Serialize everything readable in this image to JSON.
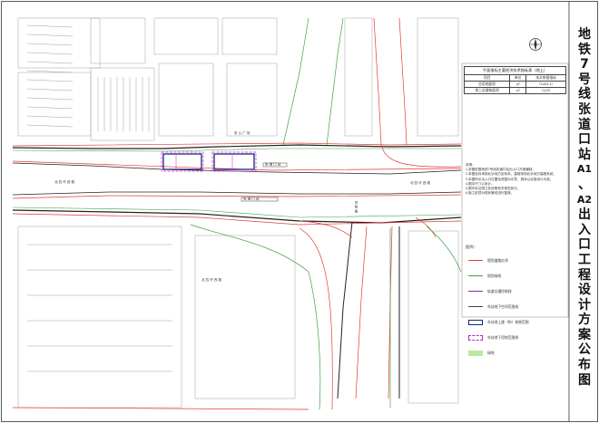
{
  "title_chars": [
    "地",
    "铁",
    "7",
    "号",
    "线",
    "张",
    "道",
    "口",
    "站",
    "A1",
    "、",
    "A2",
    "出",
    "入",
    "口",
    "工",
    "程",
    "设",
    "计",
    "方",
    "案",
    "公",
    "布",
    "图"
  ],
  "indicator_table": {
    "caption": "平面指标主要经济技术指标表（地上）",
    "headers": [
      "项目",
      "单位",
      "本次申报指标"
    ],
    "rows": [
      [
        "总用地面积",
        "㎡",
        "（1403.1）"
      ],
      [
        "地上总建筑面积",
        "㎡",
        "（123）"
      ]
    ]
  },
  "notes": {
    "heading": "说明：",
    "lines": [
      "1.本图依据地铁7号线张道口站出入口方案编制。",
      "2.本图坐标采用北京地方坐标系，高程采用北京地方高程系统。",
      "3.本图所示出入口位置及范围为示意，具体以实施设计为准。",
      "4.图中尺寸以米计。",
      "5.图中未注明之处依照有关规范执行。",
      "6.施工前须对现状管线进行复核。"
    ]
  },
  "legend": {
    "title": "图例：",
    "items": [
      {
        "label": "规划道路红线",
        "color": "#e53935",
        "style": "line"
      },
      {
        "label": "规划绿线",
        "color": "#43a047",
        "style": "line"
      },
      {
        "label": "轨道交通控制线",
        "color": "#8e24aa",
        "style": "line"
      },
      {
        "label": "车站地下空间范围线",
        "color": "#444444",
        "style": "line"
      },
      {
        "label": "车站地上建（构）筑物范围",
        "color": "#1a237e",
        "style": "box"
      },
      {
        "label": "车站地下用地范围线",
        "color": "#c026c0",
        "style": "dashbox"
      },
      {
        "label": "绿地",
        "color": "#b9e8a3",
        "style": "fill"
      }
    ]
  },
  "map_labels": {
    "road_west": "北 四 环 西 路",
    "road_east": "北 四 环 西 路",
    "north_lot": "张 公 广 场",
    "station_tag": "张 道 口 站",
    "south_block": "北 四 环 西 路",
    "cross_road": "学 院 路",
    "station_tag_2": "张 道 口 站"
  },
  "colors": {
    "red": "#e53935",
    "green": "#43a047",
    "purple": "#8e24aa",
    "magenta": "#d81bd8",
    "navy": "#1a237e",
    "lightgreen": "#b9e8a3",
    "building": "#9aa0a6"
  }
}
